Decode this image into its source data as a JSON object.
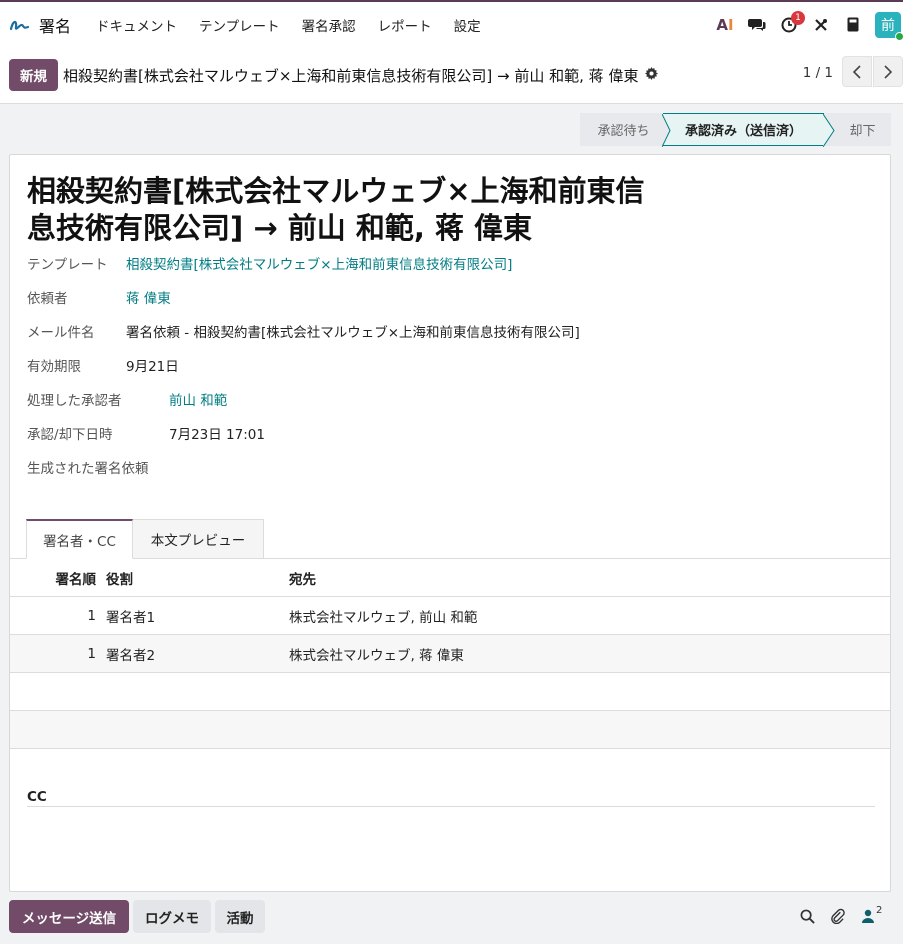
{
  "nav": {
    "app_name": "署名",
    "menu": [
      "ドキュメント",
      "テンプレート",
      "署名承認",
      "レポート",
      "設定"
    ],
    "activity_badge": "1",
    "avatar_letter": "前",
    "ai_label_a": "A",
    "ai_label_i": "I"
  },
  "control": {
    "new_button": "新規",
    "breadcrumb": "相殺契約書[株式会社マルウェブ×上海和前東信息技術有限公司] → 前山 和範, 蒋 偉東",
    "pager": "1 / 1"
  },
  "status": {
    "stages": [
      "承認待ち",
      "承認済み（送信済）",
      "却下"
    ],
    "active_index": 1
  },
  "record": {
    "title": "相殺契約書[株式会社マルウェブ×上海和前東信息技術有限公司] → 前山 和範, 蒋 偉東",
    "fields": {
      "template_label": "テンプレート",
      "template_value": "相殺契約書[株式会社マルウェブ×上海和前東信息技術有限公司]",
      "requester_label": "依頼者",
      "requester_value": "蒋 偉東",
      "subject_label": "メール件名",
      "subject_value": "署名依頼 - 相殺契約書[株式会社マルウェブ×上海和前東信息技術有限公司]",
      "expiry_label": "有効期限",
      "expiry_value": "9月21日",
      "approver_label": "処理した承認者",
      "approver_value": "前山 和範",
      "decision_date_label": "承認/却下日時",
      "decision_date_value": "7月23日 17:01",
      "generated_label": "生成された署名依頼"
    }
  },
  "tabs": [
    "署名者・CC",
    "本文プレビュー"
  ],
  "signers_table": {
    "headers": [
      "署名順",
      "役割",
      "宛先"
    ],
    "rows": [
      {
        "order": "1",
        "role": "署名者1",
        "destination": "株式会社マルウェブ, 前山 和範"
      },
      {
        "order": "1",
        "role": "署名者2",
        "destination": "株式会社マルウェブ, 蒋 偉東"
      }
    ]
  },
  "cc_label": "CC",
  "chatter": {
    "send_message": "メッセージ送信",
    "log_note": "ログメモ",
    "activity": "活動",
    "followers_count": "2"
  },
  "colors": {
    "brand": "#714b67",
    "link": "#017e84",
    "avatar": "#2ab2bd",
    "badge": "#d9363e"
  }
}
